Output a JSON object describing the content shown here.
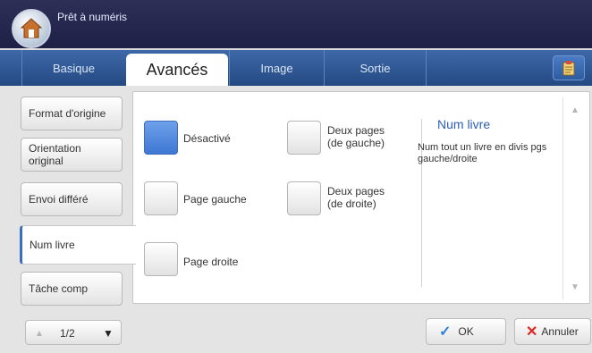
{
  "titlebar": {
    "title": "Prêt à numéris",
    "home_icon": "home-icon"
  },
  "tabs": [
    {
      "label": "Basique",
      "active": false
    },
    {
      "label": "Avancés",
      "active": true
    },
    {
      "label": "Image",
      "active": false
    },
    {
      "label": "Sortie",
      "active": false
    }
  ],
  "tabbar_icon": "clipboard-icon",
  "sidebar": {
    "items": [
      {
        "label": "Format d'origine"
      },
      {
        "label": "Orientation original"
      },
      {
        "label": "Envoi différé"
      },
      {
        "label": "Num livre",
        "active": true
      },
      {
        "label": "Tâche comp"
      }
    ]
  },
  "options": [
    {
      "label": "Désactivé",
      "selected": true
    },
    {
      "label": "Page gauche"
    },
    {
      "label": "Page droite"
    },
    {
      "label": "Deux pages (de gauche)"
    },
    {
      "label": "Deux pages (de droite)"
    }
  ],
  "info": {
    "title": "Num livre",
    "description": "Num tout un livre en divis pgs gauche/droite"
  },
  "pager": {
    "page": "1/2"
  },
  "footer": {
    "ok_label": "OK",
    "cancel_label": "Annuler"
  },
  "colors": {
    "accent": "#3d6cc0",
    "title_bar": "#2e2f57",
    "tab_bar": "#3e68a8"
  }
}
